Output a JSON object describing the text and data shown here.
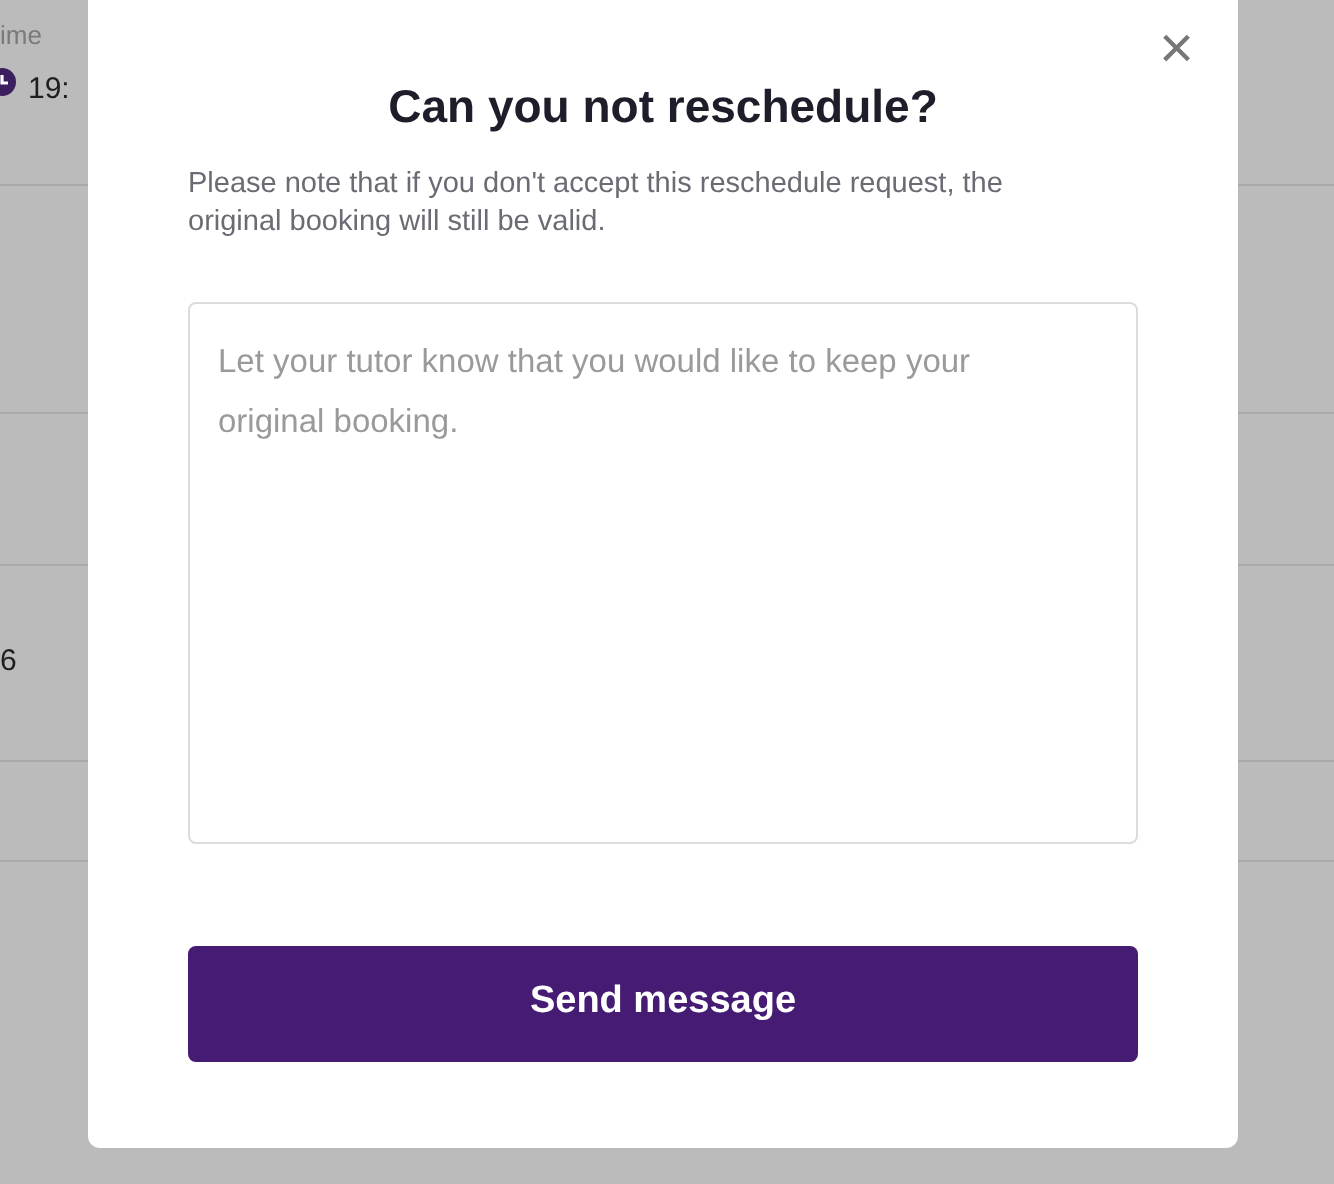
{
  "background_table": {
    "column_header": "ime",
    "rows": [
      {
        "kind": "time",
        "text": "19:"
      },
      {
        "kind": "blank"
      },
      {
        "kind": "blank"
      },
      {
        "kind": "plain",
        "text": "6"
      },
      {
        "kind": "blank"
      }
    ]
  },
  "modal": {
    "close": "×",
    "title": "Can you not reschedule?",
    "note": "Please note that if you don't accept this reschedule request, the original booking will still be valid.",
    "message": {
      "placeholder": "Let your tutor know that you would like to keep your original booking."
    },
    "button": "Send message"
  }
}
